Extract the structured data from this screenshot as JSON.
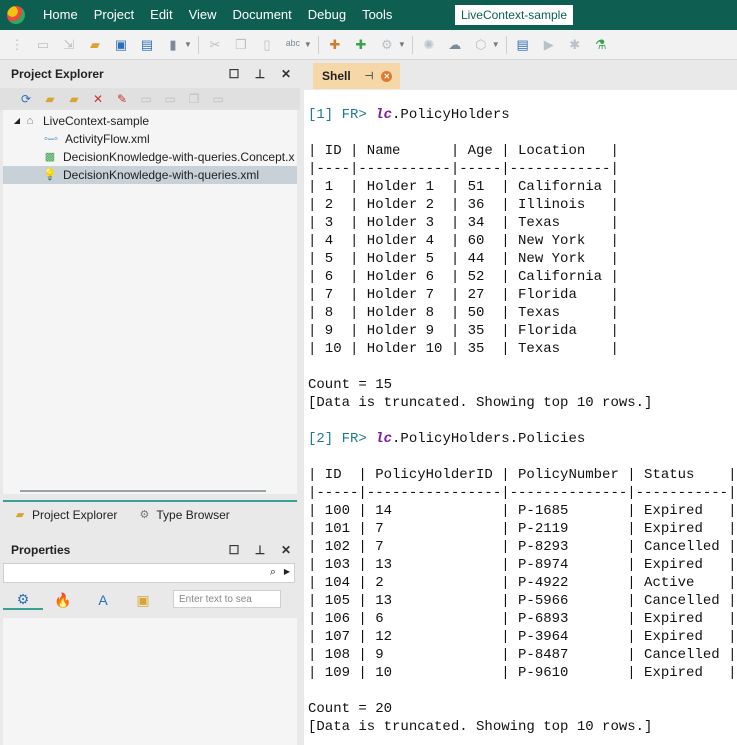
{
  "menu": {
    "items": [
      "Home",
      "Project",
      "Edit",
      "View",
      "Document",
      "Debug",
      "Tools"
    ],
    "window_title": "LiveContext-sample"
  },
  "project_explorer": {
    "title": "Project Explorer",
    "tree": {
      "root": "LiveContext-sample",
      "items": [
        {
          "label": "ActivityFlow.xml",
          "icon": "flow-icon"
        },
        {
          "label": "DecisionKnowledge-with-queries.Concept.x",
          "icon": "concept-icon"
        },
        {
          "label": "DecisionKnowledge-with-queries.xml",
          "icon": "bulb-icon",
          "selected": true
        }
      ]
    },
    "bottom_tabs": [
      "Project Explorer",
      "Type Browser"
    ]
  },
  "properties": {
    "title": "Properties",
    "search_placeholder": "Enter text to sea"
  },
  "shell": {
    "tab_label": "Shell",
    "query1": {
      "index": "[1]",
      "prompt": "FR>",
      "lc": "lc",
      "expr": ".PolicyHolders"
    },
    "table1": {
      "headers": [
        "ID",
        "Name",
        "Age",
        "Location"
      ],
      "rows": [
        [
          "1",
          "Holder 1",
          "51",
          "California"
        ],
        [
          "2",
          "Holder 2",
          "36",
          "Illinois"
        ],
        [
          "3",
          "Holder 3",
          "34",
          "Texas"
        ],
        [
          "4",
          "Holder 4",
          "60",
          "New York"
        ],
        [
          "5",
          "Holder 5",
          "44",
          "New York"
        ],
        [
          "6",
          "Holder 6",
          "52",
          "California"
        ],
        [
          "7",
          "Holder 7",
          "27",
          "Florida"
        ],
        [
          "8",
          "Holder 8",
          "50",
          "Texas"
        ],
        [
          "9",
          "Holder 9",
          "35",
          "Florida"
        ],
        [
          "10",
          "Holder 10",
          "35",
          "Texas"
        ]
      ],
      "count": "Count = 15",
      "note": "[Data is truncated. Showing top 10 rows.]"
    },
    "query2": {
      "index": "[2]",
      "prompt": "FR>",
      "lc": "lc",
      "expr": ".PolicyHolders.Policies"
    },
    "table2": {
      "headers": [
        "ID",
        "PolicyHolderID",
        "PolicyNumber",
        "Status"
      ],
      "rows": [
        [
          "100",
          "14",
          "P-1685",
          "Expired"
        ],
        [
          "101",
          "7",
          "P-2119",
          "Expired"
        ],
        [
          "102",
          "7",
          "P-8293",
          "Cancelled"
        ],
        [
          "103",
          "13",
          "P-8974",
          "Expired"
        ],
        [
          "104",
          "2",
          "P-4922",
          "Active"
        ],
        [
          "105",
          "13",
          "P-5966",
          "Cancelled"
        ],
        [
          "106",
          "6",
          "P-6893",
          "Expired"
        ],
        [
          "107",
          "12",
          "P-3964",
          "Expired"
        ],
        [
          "108",
          "9",
          "P-8487",
          "Cancelled"
        ],
        [
          "109",
          "10",
          "P-9610",
          "Expired"
        ]
      ],
      "count": "Count = 20",
      "note": "[Data is truncated. Showing top 10 rows.]"
    }
  }
}
